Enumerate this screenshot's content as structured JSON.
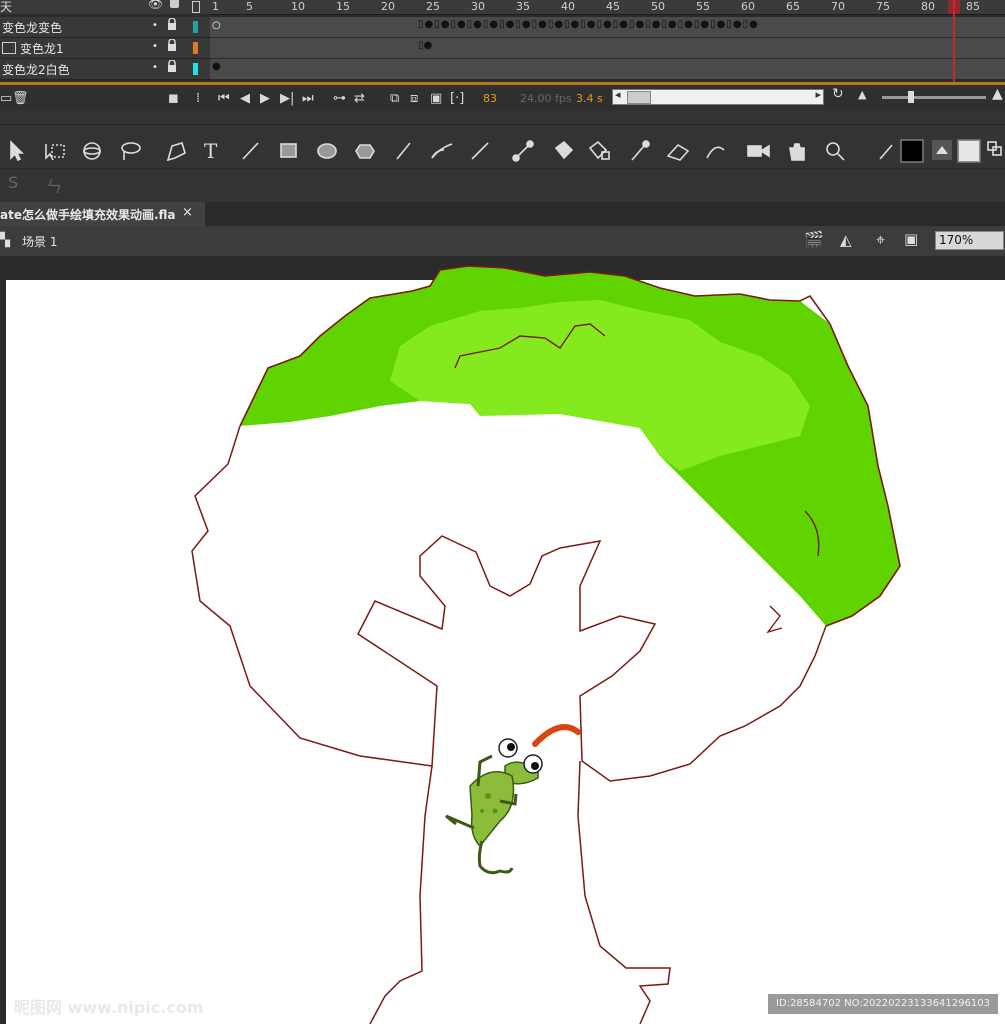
{
  "timeline": {
    "header_label": "天",
    "ruler_ticks": [
      "1",
      "5",
      "10",
      "15",
      "20",
      "25",
      "30",
      "35",
      "40",
      "45",
      "50",
      "55",
      "60",
      "65",
      "70",
      "75",
      "80",
      "85"
    ],
    "layers": [
      {
        "name": "变色龙变色",
        "color": "#1fa3a3"
      },
      {
        "name": "变色龙1",
        "color": "#e07a1a"
      },
      {
        "name": "变色龙2白色",
        "color": "#22e0e8"
      }
    ],
    "current_frame": "83",
    "fps": "24.00 fps",
    "time": "3.4 s"
  },
  "document": {
    "tab_title": "ate怎么做手绘填充效果动画.fla",
    "close_label": "×",
    "scene_label": "场景 1",
    "zoom": "170%"
  },
  "tools": [
    "selection-icon",
    "subselection-icon",
    "3d-rotation-icon",
    "lasso-icon",
    "pen-icon",
    "text-icon",
    "line-icon",
    "rectangle-icon",
    "oval-icon",
    "polystar-icon",
    "pencil-icon",
    "paintbrush-icon",
    "brush-icon",
    "bone-icon",
    "paint-bucket-icon",
    "ink-bottle-icon",
    "eyedropper-icon",
    "eraser-icon",
    "width-icon",
    "camera-icon",
    "hand-icon",
    "zoom-icon",
    "stroke-color-icon",
    "fill-color-icon"
  ],
  "colors": {
    "stroke": "#000000",
    "fill": "#e6e6e6",
    "leaf_dark": "#5fd400",
    "leaf_light": "#84ea1e",
    "outline": "#7a1a14"
  },
  "watermark": {
    "left": "昵图网 www.nipic.com",
    "right": "ID:28584702 NO:20220223133641296103"
  }
}
